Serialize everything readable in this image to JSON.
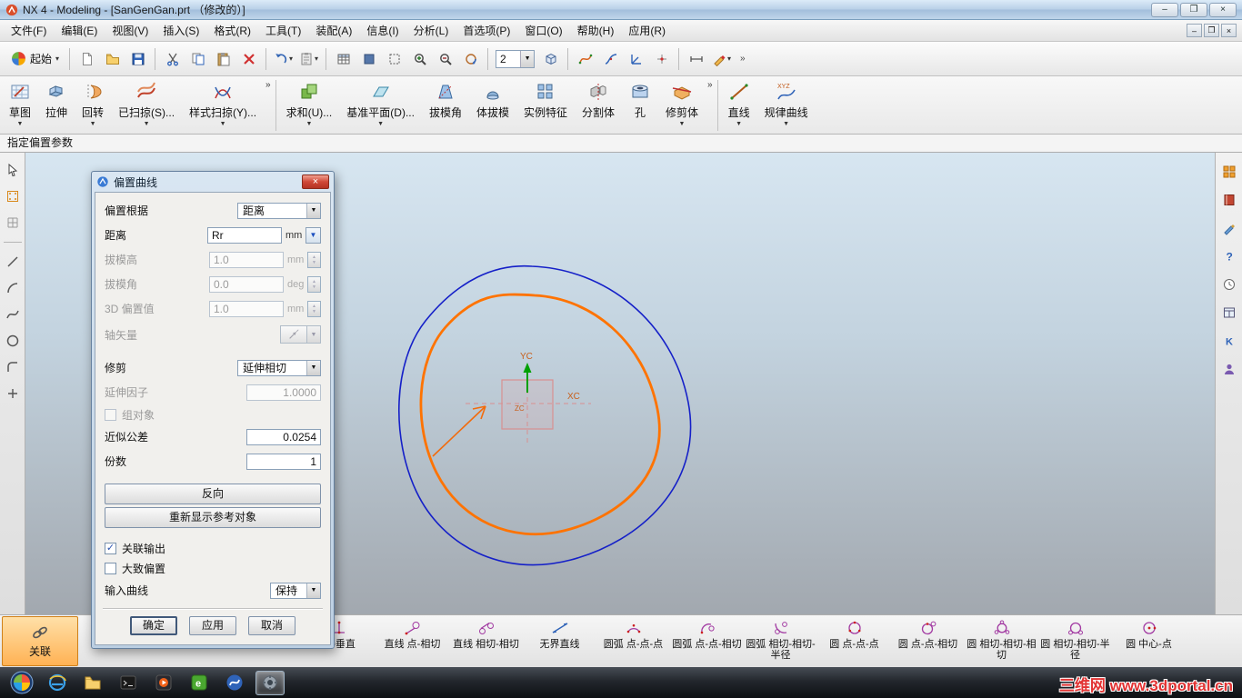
{
  "titlebar": {
    "title": "NX 4 - Modeling - [SanGenGan.prt （修改的）]"
  },
  "menubar": {
    "items": [
      "文件(F)",
      "编辑(E)",
      "视图(V)",
      "插入(S)",
      "格式(R)",
      "工具(T)",
      "装配(A)",
      "信息(I)",
      "分析(L)",
      "首选项(P)",
      "窗口(O)",
      "帮助(H)",
      "应用(R)"
    ]
  },
  "standard_toolbar": {
    "start_label": "起始",
    "layer_value": "2",
    "items": [
      {
        "name": "new-document-icon"
      },
      {
        "name": "open-folder-icon"
      },
      {
        "name": "save-icon"
      },
      {
        "sep": true
      },
      {
        "name": "cut-icon"
      },
      {
        "name": "copy-icon"
      },
      {
        "name": "paste-icon"
      },
      {
        "name": "delete-icon"
      },
      {
        "sep": true
      },
      {
        "name": "undo-icon",
        "dropdown": true
      },
      {
        "name": "clipboard-icon",
        "dropdown": true
      },
      {
        "sep": true
      },
      {
        "name": "table-icon"
      },
      {
        "name": "shaded-view-icon"
      },
      {
        "name": "wireframe-view-icon"
      },
      {
        "name": "zoom-in-icon"
      },
      {
        "name": "zoom-out-icon"
      },
      {
        "name": "rotate-view-icon"
      },
      {
        "sep": true
      },
      {
        "layer": true
      },
      {
        "name": "cube-icon"
      },
      {
        "sep": true
      },
      {
        "name": "spline-icon"
      },
      {
        "name": "curve-icon"
      },
      {
        "name": "datum-axis-icon"
      },
      {
        "name": "point-icon"
      },
      {
        "sep": true
      },
      {
        "name": "measure-icon"
      },
      {
        "name": "sketch-pencil-icon",
        "dropdown": true
      }
    ]
  },
  "feature_toolbar": {
    "items": [
      {
        "name": "sketch-icon",
        "label": "草图",
        "dropdown": true
      },
      {
        "name": "extrude-icon",
        "label": "拉伸"
      },
      {
        "name": "revolve-icon",
        "label": "回转",
        "dropdown": true
      },
      {
        "name": "swept-icon",
        "label": "已扫掠(S)...",
        "dropdown": true
      },
      {
        "name": "styled-sweep-icon",
        "label": "样式扫掠(Y)...",
        "dropdown": true
      },
      {
        "chevron": true
      },
      {
        "sep": true
      },
      {
        "name": "unite-icon",
        "label": "求和(U)...",
        "dropdown": true
      },
      {
        "name": "datum-plane-icon",
        "label": "基准平面(D)...",
        "dropdown": true
      },
      {
        "name": "draft-angle-icon",
        "label": "拔模角"
      },
      {
        "name": "body-taper-icon",
        "label": "体拔模"
      },
      {
        "name": "instance-feature-icon",
        "label": "实例特征"
      },
      {
        "name": "split-body-icon",
        "label": "分割体"
      },
      {
        "name": "hole-icon",
        "label": "孔"
      },
      {
        "name": "trim-body-icon",
        "label": "修剪体",
        "dropdown": true
      },
      {
        "chevron": true
      },
      {
        "sep": true
      },
      {
        "name": "line-feature-icon",
        "label": "直线",
        "dropdown": true
      },
      {
        "name": "law-curve-icon",
        "label": "规律曲线",
        "dropdown": true
      }
    ]
  },
  "prompt_bar": {
    "text": "指定偏置参数"
  },
  "canvas": {
    "wcs": {
      "yc": "YC",
      "xc": "XC",
      "zc": "ZC"
    }
  },
  "dialog": {
    "title": "偏置曲线",
    "rows": {
      "offset_by": {
        "label": "偏置根据",
        "value": "距离"
      },
      "distance": {
        "label": "距离",
        "value": "Rr",
        "unit": "mm"
      },
      "draft_height": {
        "label": "拔模高",
        "value": "1.0",
        "unit": "mm"
      },
      "draft_angle": {
        "label": "拔模角",
        "value": "0.0",
        "unit": "deg"
      },
      "offset_3d": {
        "label": "3D 偏置值",
        "value": "1.0",
        "unit": "mm"
      },
      "axis_vector": {
        "label": "轴矢量"
      },
      "trim": {
        "label": "修剪",
        "value": "延伸相切"
      },
      "extension_factor": {
        "label": "延伸因子",
        "value": "1.0000"
      },
      "group_object": {
        "label": "组对象",
        "checked": false
      },
      "tolerance": {
        "label": "近似公差",
        "value": "0.0254"
      },
      "copies": {
        "label": "份数",
        "value": "1"
      },
      "assoc_output": {
        "label": "关联输出",
        "checked": true
      },
      "rough_offset": {
        "label": "大致偏置",
        "checked": false
      },
      "input_curve": {
        "label": "输入曲线",
        "value": "保持"
      }
    },
    "buttons": {
      "reverse": "反向",
      "redisplay": "重新显示参考对象",
      "ok": "确定",
      "apply": "应用",
      "cancel": "取消"
    }
  },
  "left_toolbar": {
    "items": [
      {
        "name": "select-filter-icon"
      },
      {
        "name": "snap-point-icon"
      },
      {
        "name": "grid-snap-icon"
      },
      {
        "sep": true
      },
      {
        "name": "line-tool-icon"
      },
      {
        "name": "arc-tool-icon"
      },
      {
        "name": "spline-tool-icon"
      },
      {
        "name": "circle-tool-icon"
      },
      {
        "name": "fillet-tool-icon"
      },
      {
        "name": "point-tool-icon"
      }
    ]
  },
  "right_toolbar": {
    "items": [
      {
        "name": "palette-icon"
      },
      {
        "name": "book-icon"
      },
      {
        "name": "pencil-3d-icon"
      },
      {
        "name": "question-icon"
      },
      {
        "name": "clock-icon"
      },
      {
        "name": "window-grid-icon"
      },
      {
        "name": "k-badge-icon"
      },
      {
        "name": "person-icon"
      }
    ]
  },
  "bottom_toolbar": {
    "assoc": {
      "label": "关联"
    },
    "items": [
      {
        "name": "line-point-perpendicular",
        "label": "点-垂直"
      },
      {
        "name": "line-point-tangent",
        "label": "直线 点-相切"
      },
      {
        "name": "line-tangent-tangent",
        "label": "直线 相切-相切"
      },
      {
        "name": "unbounded-line",
        "label": "无界直线"
      },
      {
        "name": "arc-point-point-point",
        "label": "圆弧 点-点-点"
      },
      {
        "name": "arc-point-point-tangent",
        "label": "圆弧 点-点-相切"
      },
      {
        "name": "arc-tangent-tangent-radius",
        "label": "圆弧 相切-相切-半径"
      },
      {
        "name": "circle-point-point-point",
        "label": "圆 点-点-点"
      },
      {
        "name": "circle-point-point-tangent",
        "label": "圆 点-点-相切"
      },
      {
        "name": "circle-tangent-tangent-tangent",
        "label": "圆 相切-相切-相切"
      },
      {
        "name": "circle-tangent-tangent-radius",
        "label": "圆 相切-相切-半径"
      },
      {
        "name": "circle-center-point",
        "label": "圆 中心-点"
      }
    ]
  },
  "taskbar": {
    "items": [
      {
        "name": "start-orb"
      },
      {
        "name": "ie-icon"
      },
      {
        "name": "explorer-icon"
      },
      {
        "name": "console-icon"
      },
      {
        "name": "media-icon"
      },
      {
        "name": "green-app-icon"
      },
      {
        "name": "nx-swirl-icon"
      },
      {
        "name": "nx-gear-icon",
        "active": true
      }
    ]
  },
  "watermark": {
    "text": "三维网 www.3dportal.cn"
  }
}
